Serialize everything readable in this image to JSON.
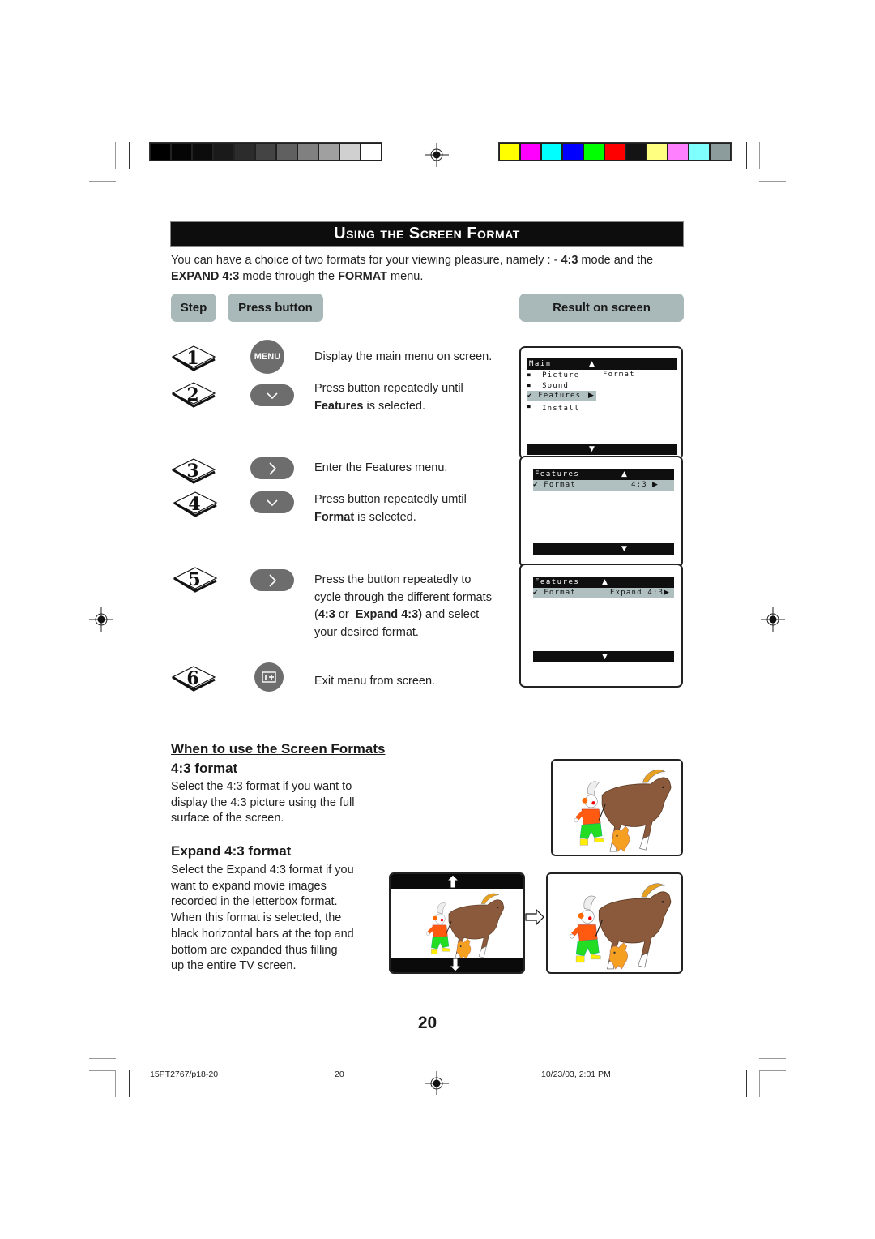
{
  "print_marks": {
    "grayscale_swatches": [
      "#000000",
      "#050505",
      "#0c0c0c",
      "#1a1a1a",
      "#2c2c2c",
      "#444444",
      "#606060",
      "#808080",
      "#a0a0a0",
      "#d0d0d0",
      "#ffffff"
    ],
    "color_swatches": [
      "#ffff00",
      "#ff00ff",
      "#00ffff",
      "#0000ff",
      "#00ff00",
      "#ff0000",
      "#141414",
      "#ffff80",
      "#ff80ff",
      "#80ffff",
      "#8c9c9c"
    ]
  },
  "header": {
    "title": "Using the Screen Format"
  },
  "intro": {
    "part1": "You can have a choice of two formats for your viewing pleasure, namely : - ",
    "bold1": "4:3",
    "part2": " mode and the ",
    "bold2": "EXPAND 4:3",
    "part3": " mode through the ",
    "bold3": "FORMAT",
    "part4": " menu."
  },
  "columns": {
    "step": "Step",
    "press_button": "Press button",
    "result": "Result on screen"
  },
  "steps": [
    {
      "num": "1",
      "button": "MENU",
      "button_icon": "menu-button",
      "text": "Display the main menu on screen."
    },
    {
      "num": "2",
      "button_icon": "down-arrow-button",
      "text_pre": "Press button repeatedly until",
      "text_bold": "Features",
      "text_post": " is selected."
    },
    {
      "num": "3",
      "button_icon": "right-arrow-button",
      "text": "Enter the Features menu."
    },
    {
      "num": "4",
      "button_icon": "down-arrow-button",
      "text_pre": "Press button repeatedly umtil",
      "text_bold": "Format",
      "text_post": " is selected."
    },
    {
      "num": "5",
      "button_icon": "right-arrow-button",
      "text_l1": "Press the button repeatedly to",
      "text_l2": "cycle through the different formats",
      "text_l3_open": "(",
      "text_l3_b1": "4:3",
      "text_l3_mid": " or  ",
      "text_l3_b2": "Expand 4:3)",
      "text_l3_end": " and select",
      "text_l4": "your desired format."
    },
    {
      "num": "6",
      "button_icon": "osd-exit-button",
      "text": "Exit menu from screen."
    }
  ],
  "osd_screens": [
    {
      "header": "Main",
      "items": [
        {
          "bullet": "■",
          "label": "Picture",
          "value": "Format",
          "selected": false
        },
        {
          "bullet": "■",
          "label": "Sound",
          "selected": false
        },
        {
          "bullet": "✔",
          "label": "Features",
          "arrow": "▶",
          "selected": true
        },
        {
          "bullet": "■",
          "label": "Install",
          "selected": false
        }
      ]
    },
    {
      "header": "Features",
      "items": [
        {
          "bullet": "✔",
          "label": "Format",
          "value": "4:3",
          "arrow": "▶",
          "selected": true
        }
      ]
    },
    {
      "header": "Features",
      "items": [
        {
          "bullet": "✔",
          "label": "Format",
          "value": "Expand 4:3",
          "arrow": "▶",
          "selected": true
        }
      ]
    }
  ],
  "usage": {
    "heading": "When to use the Screen Formats",
    "fmt43": {
      "heading": "4:3 format",
      "lines": [
        "Select the 4:3 format if you want to",
        "display the 4:3 picture using the full",
        "surface of the screen."
      ]
    },
    "expand": {
      "heading": "Expand 4:3 format",
      "lines": [
        "Select the Expand 4:3 format if you",
        "want to expand movie images",
        "recorded in the letterbox format.",
        "When this format is selected, the",
        "black horizontal bars at the top and",
        "bottom are expanded thus filling",
        "up the entire TV screen."
      ]
    }
  },
  "page_number": "20",
  "footer": {
    "file": "15PT2767/p18-20",
    "page": "20",
    "timestamp": "10/23/03, 2:01 PM"
  }
}
